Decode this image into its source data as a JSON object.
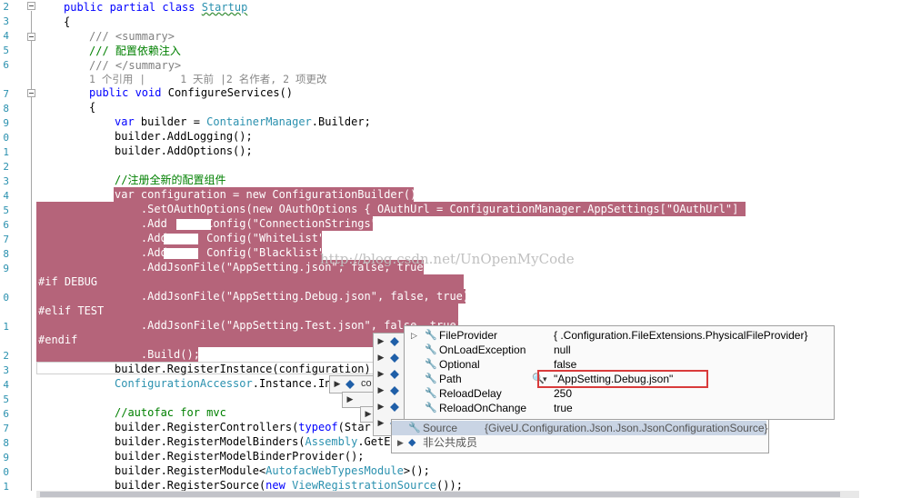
{
  "gutter": {
    "line_numbers": [
      "2",
      "3",
      "4",
      "5",
      "6",
      "7",
      "8",
      "9",
      "0",
      "1",
      "2",
      "3",
      "4",
      "5",
      "6",
      "7",
      "8",
      "9",
      "0",
      "1",
      "2",
      "3",
      "4",
      "5",
      "6",
      "7",
      "8",
      "9",
      "0",
      "1",
      "2",
      "3",
      "4"
    ]
  },
  "code": {
    "class_decl": {
      "kw": "public partial class",
      "name": "Startup"
    },
    "open_brace_1": "{",
    "summary_open": "/// <summary>",
    "summary_text": "/// 配置依赖注入",
    "summary_close": "/// </summary>",
    "codelens": {
      "refs": "1 个引用 |",
      "changes": "1 天前 |2 名作者, 2 项更改"
    },
    "method_decl": {
      "kw": "public void",
      "name": "ConfigureServices()"
    },
    "open_brace_2": "{",
    "builder_decl": {
      "kw": "var",
      "text1": " builder = ",
      "type": "ContainerManager",
      "text2": ".Builder;"
    },
    "add_logging": "builder.AddLogging();",
    "add_options": "builder.AddOptions();",
    "comment_config": "//注册全新的配置组件",
    "sel_lines": [
      "var configuration = new ConfigurationBuilder()",
      "    .SetOAuthOptions(new OAuthOptions { OAuthUrl = ConfigurationManager.AppSettings[\"OAuthUrl\"] })",
      "    .Add      Config(\"ConnectionStrings\")",
      "    .Add      Config(\"WhiteList\")",
      "    .Add      Config(\"Blacklist\")",
      "    .AddJsonFile(\"AppSetting.json\", false, true)",
      "#if DEBUG",
      "    .AddJsonFile(\"AppSetting.Debug.json\", false, true)",
      "#elif TEST",
      "    .AddJsonFile(\"AppSetting.Test.json\", false, true)",
      "#endif",
      "    .Build();"
    ],
    "register_instance": "builder.RegisterInstance(configuration).A",
    "config_accessor": {
      "type": "ConfigurationAccessor",
      "text": ".Instance.Ini"
    },
    "comment_autofac": "//autofac for mvc",
    "register_controllers": {
      "a": "builder.RegisterControllers(",
      "kw": "typeof",
      "b": "(Star"
    },
    "register_binders": {
      "a": "builder.RegisterModelBinders(",
      "type": "Assembly",
      "b": ".GetEx"
    },
    "register_binder_provider": "builder.RegisterModelBinderProvider();",
    "register_module": {
      "a": "builder.RegisterModule<",
      "type": "AutofacWebTypesModule",
      "b": ">();"
    },
    "register_source": {
      "a": "builder.RegisterSource(",
      "kw": "new",
      "type": "ViewRegistrationSource",
      "b": "());"
    }
  },
  "watermark": "http://blog.csdn.net/UnOpenMyCode",
  "tip_stack": {
    "co": "co"
  },
  "datatip": {
    "rows": [
      {
        "name": "FileProvider",
        "value": "{        .Configuration.FileExtensions.PhysicalFileProvider}"
      },
      {
        "name": "OnLoadException",
        "value": "null"
      },
      {
        "name": "Optional",
        "value": "false"
      },
      {
        "name": "Path",
        "value": "\"AppSetting.Debug.json\""
      },
      {
        "name": "ReloadDelay",
        "value": "250"
      },
      {
        "name": "ReloadOnChange",
        "value": "true"
      }
    ],
    "source": {
      "name": "Source",
      "value": "{GiveU.Configuration.Json.Json.JsonConfigurationSource}"
    },
    "nonpublic": {
      "name": "非公共成员"
    }
  },
  "colors": {
    "selection": "#b5647a",
    "keyword": "#0000ff",
    "type": "#2b91af",
    "comment": "#008000",
    "highlight_border": "#d93b3b"
  }
}
